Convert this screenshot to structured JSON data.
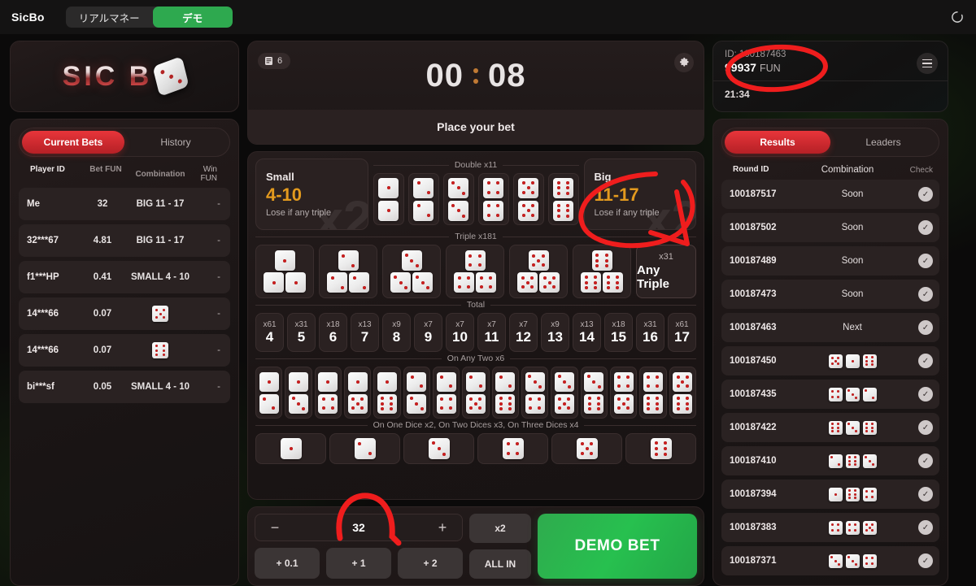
{
  "topbar": {
    "brand": "SicBo",
    "mode_real": "リアルマネー",
    "mode_demo": "デモ",
    "refresh_icon": "refresh-icon"
  },
  "logo": {
    "text": "SIC B",
    "die_face": 3
  },
  "left_panel": {
    "tabs": [
      {
        "label": "Current Bets",
        "active": true
      },
      {
        "label": "History",
        "active": false
      }
    ],
    "columns": [
      "Player ID",
      "Bet  FUN",
      "Combination",
      "Win  FUN"
    ],
    "rows": [
      {
        "player": "Me",
        "bet": "32",
        "combination": "BIG 11 - 17",
        "dice": null,
        "win": "-"
      },
      {
        "player": "32***67",
        "bet": "4.81",
        "combination": "BIG 11 - 17",
        "dice": null,
        "win": "-"
      },
      {
        "player": "f1***HP",
        "bet": "0.41",
        "combination": "SMALL 4 - 10",
        "dice": null,
        "win": "-"
      },
      {
        "player": "14***66",
        "bet": "0.07",
        "combination": "",
        "dice": [
          5
        ],
        "win": "-"
      },
      {
        "player": "14***66",
        "bet": "0.07",
        "combination": "",
        "dice": [
          6
        ],
        "win": "-"
      },
      {
        "player": "bi***sf",
        "bet": "0.05",
        "combination": "SMALL 4 - 10",
        "dice": null,
        "win": "-"
      }
    ]
  },
  "game": {
    "round_badge": "6",
    "round_badge_icon": "ticket-icon",
    "settings_icon": "gear-icon",
    "timer_minutes": "00",
    "timer_seconds": "08",
    "status": "Place your bet",
    "small": {
      "title": "Small",
      "range": "4-10",
      "note": "Lose if any triple",
      "multiplier": "x2"
    },
    "big": {
      "title": "Big",
      "range": "11-17",
      "note": "Lose if any triple",
      "multiplier": "x2"
    },
    "double_label": "Double x11",
    "double_faces": [
      1,
      2,
      3,
      4,
      5,
      6
    ],
    "triple_label": "Triple x181",
    "triple_faces": [
      1,
      2,
      3,
      4,
      5,
      6
    ],
    "any_triple": {
      "multiplier": "x31",
      "label": "Any Triple"
    },
    "total_label": "Total",
    "totals": [
      {
        "n": "4",
        "m": "x61"
      },
      {
        "n": "5",
        "m": "x31"
      },
      {
        "n": "6",
        "m": "x18"
      },
      {
        "n": "7",
        "m": "x13"
      },
      {
        "n": "8",
        "m": "x9"
      },
      {
        "n": "9",
        "m": "x7"
      },
      {
        "n": "10",
        "m": "x7"
      },
      {
        "n": "11",
        "m": "x7"
      },
      {
        "n": "12",
        "m": "x7"
      },
      {
        "n": "13",
        "m": "x9"
      },
      {
        "n": "14",
        "m": "x13"
      },
      {
        "n": "15",
        "m": "x18"
      },
      {
        "n": "16",
        "m": "x31"
      },
      {
        "n": "17",
        "m": "x61"
      }
    ],
    "any_two_label": "On Any Two x6",
    "any_two_pairs": [
      [
        1,
        2
      ],
      [
        1,
        3
      ],
      [
        1,
        4
      ],
      [
        1,
        5
      ],
      [
        1,
        6
      ],
      [
        2,
        3
      ],
      [
        2,
        4
      ],
      [
        2,
        5
      ],
      [
        2,
        6
      ],
      [
        3,
        4
      ],
      [
        3,
        5
      ],
      [
        3,
        6
      ],
      [
        4,
        5
      ],
      [
        4,
        6
      ],
      [
        5,
        6
      ]
    ],
    "one_dice_label": "On One Dice x2, On Two Dices x3, On Three Dices x4",
    "single_faces": [
      1,
      2,
      3,
      4,
      5,
      6
    ]
  },
  "controls": {
    "minus": "−",
    "amount": "32",
    "plus": "+",
    "double_bet": "x2",
    "quick": [
      "+ 0.1",
      "+ 1",
      "+ 2"
    ],
    "all_in": "ALL IN",
    "bet_button": "DEMO BET"
  },
  "balance": {
    "id_label": "ID: 100187463",
    "amount": "99937",
    "currency": "FUN",
    "time": "21:34",
    "menu_icon": "hamburger-menu-icon"
  },
  "right_panel": {
    "tabs": [
      {
        "label": "Results",
        "active": true
      },
      {
        "label": "Leaders",
        "active": false
      }
    ],
    "columns": [
      "Round ID",
      "Combination",
      "Check"
    ],
    "rows": [
      {
        "round_id": "100187517",
        "status": "Soon",
        "dice": null
      },
      {
        "round_id": "100187502",
        "status": "Soon",
        "dice": null
      },
      {
        "round_id": "100187489",
        "status": "Soon",
        "dice": null
      },
      {
        "round_id": "100187473",
        "status": "Soon",
        "dice": null
      },
      {
        "round_id": "100187463",
        "status": "Next",
        "dice": null
      },
      {
        "round_id": "100187450",
        "status": "",
        "dice": [
          5,
          1,
          6
        ]
      },
      {
        "round_id": "100187435",
        "status": "",
        "dice": [
          4,
          3,
          2
        ]
      },
      {
        "round_id": "100187422",
        "status": "",
        "dice": [
          6,
          3,
          6
        ]
      },
      {
        "round_id": "100187410",
        "status": "",
        "dice": [
          2,
          6,
          3
        ]
      },
      {
        "round_id": "100187394",
        "status": "",
        "dice": [
          1,
          6,
          4
        ]
      },
      {
        "round_id": "100187383",
        "status": "",
        "dice": [
          4,
          4,
          5
        ]
      },
      {
        "round_id": "100187371",
        "status": "",
        "dice": [
          3,
          3,
          4
        ]
      }
    ],
    "check_icon": "check-circle-icon"
  },
  "colors": {
    "accent_red": "#d2272c",
    "accent_green": "#2ea94f",
    "accent_gold": "#e39a1e",
    "pip_red": "#cf1f1f",
    "annotation_red": "#ef1d1d"
  },
  "annotations": [
    {
      "name": "balance-circle",
      "shape": "ellipse"
    },
    {
      "name": "big-circle-arrow",
      "shape": "circle-arrow"
    },
    {
      "name": "bet-amount-arrow",
      "shape": "arc-arrow"
    }
  ]
}
